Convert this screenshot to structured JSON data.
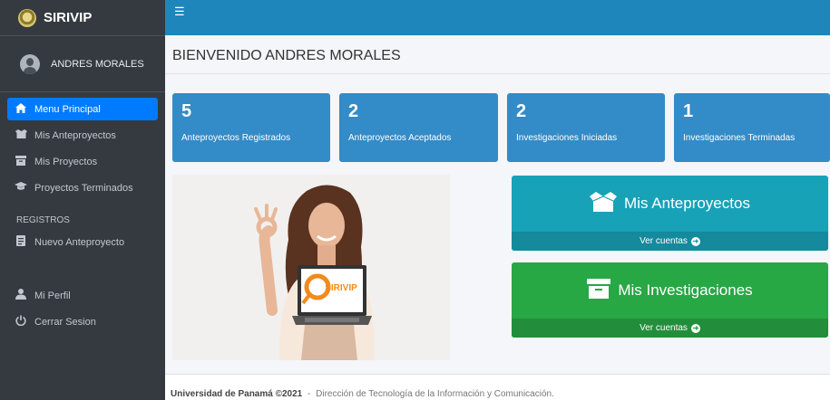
{
  "brand": {
    "name": "SIRIVIP"
  },
  "user": {
    "name": "ANDRES MORALES"
  },
  "nav": {
    "items": [
      {
        "label": "Menu Principal",
        "icon": "home-icon",
        "active": true
      },
      {
        "label": "Mis Anteproyectos",
        "icon": "box-open-icon"
      },
      {
        "label": "Mis Proyectos",
        "icon": "archive-icon"
      },
      {
        "label": "Proyectos Terminados",
        "icon": "graduation-cap-icon"
      }
    ],
    "section_header": "REGISTROS",
    "registros": [
      {
        "label": "Nuevo Anteproyecto",
        "icon": "file-icon"
      }
    ],
    "bottom": [
      {
        "label": "Mi Perfil",
        "icon": "user-tie-icon"
      },
      {
        "label": "Cerrar Sesion",
        "icon": "power-icon"
      }
    ]
  },
  "topbar": {
    "menu_icon": "hamburger-icon"
  },
  "page": {
    "title": "BIENVENIDO ANDRES MORALES"
  },
  "stats": [
    {
      "value": "5",
      "label": "Anteproyectos Registrados"
    },
    {
      "value": "2",
      "label": "Anteproyectos Aceptados"
    },
    {
      "value": "2",
      "label": "Investigaciones Iniciadas"
    },
    {
      "value": "1",
      "label": "Investigaciones Terminadas"
    }
  ],
  "hero": {
    "laptop_logo_text": "SIRIVIP"
  },
  "cards": [
    {
      "title": "Mis Anteproyectos",
      "link": "Ver cuentas",
      "icon": "box-open-icon",
      "color": "#17a2b8"
    },
    {
      "title": "Mis Investigaciones",
      "link": "Ver cuentas",
      "icon": "archive-icon",
      "color": "#28a745"
    }
  ],
  "footer": {
    "org": "Universidad de Panamá ©2021",
    "separator": "-",
    "dept": "Dirección de Tecnología de la Información y Comunicación."
  },
  "colors": {
    "sidebar": "#343a40",
    "topbar": "#1f86bc",
    "active": "#007bff",
    "stat": "#338bc7"
  }
}
